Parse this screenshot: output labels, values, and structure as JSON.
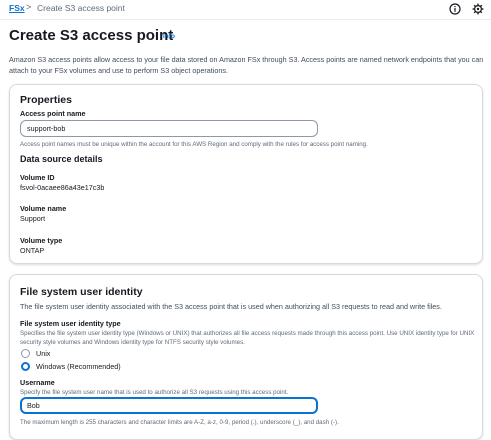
{
  "breadcrumb": {
    "root": "FSx",
    "separator": ">",
    "current": "Create S3 access point"
  },
  "header": {
    "title": "Create S3 access point",
    "info": "Info",
    "description": "Amazon S3 access points allow access to your file data stored on Amazon FSx through S3. Access points are named network endpoints that you can attach to your FSx volumes and use to perform S3 object operations."
  },
  "properties": {
    "heading": "Properties",
    "access_point_name": {
      "label": "Access point name",
      "value": "support-bob",
      "hint": "Access point names must be unique within the account for this AWS Region and comply with the rules for access point naming."
    }
  },
  "data_source": {
    "heading": "Data source details",
    "volume_id": {
      "label": "Volume ID",
      "value": "fsvol-0acaee86a43e17c3b"
    },
    "volume_name": {
      "label": "Volume name",
      "value": "Support"
    },
    "volume_type": {
      "label": "Volume type",
      "value": "ONTAP"
    }
  },
  "identity": {
    "heading": "File system user identity",
    "description": "The file system user identity associated with the S3 access point that is used when authorizing all S3 requests to read and write files.",
    "type": {
      "label": "File system user identity type",
      "hint": "Specifies the file system user identity type (Windows or UNIX) that authorizes all file access requests made through this access point. Use UNIX identity type for UNIX security style volumes and Windows identity type for NTFS security style volumes.",
      "options": [
        {
          "label": "Unix",
          "selected": false
        },
        {
          "label": "Windows (Recommended)",
          "selected": true
        }
      ]
    },
    "username": {
      "label": "Username",
      "hint": "Specify the file system user name that is used to authorize all S3 requests using this access point.",
      "value": "Bob",
      "constraint": "The maximum length is 255 characters and character limits are A-Z, a-z, 0-9, period (.), underscore (_), and dash (-)."
    }
  },
  "icons": {
    "help": "info-circle-icon",
    "settings": "settings-gear-icon"
  },
  "colors": {
    "accent": "#0972d3",
    "text": "#16191f",
    "muted": "#5f6b7a",
    "border": "#d5dbdb"
  }
}
